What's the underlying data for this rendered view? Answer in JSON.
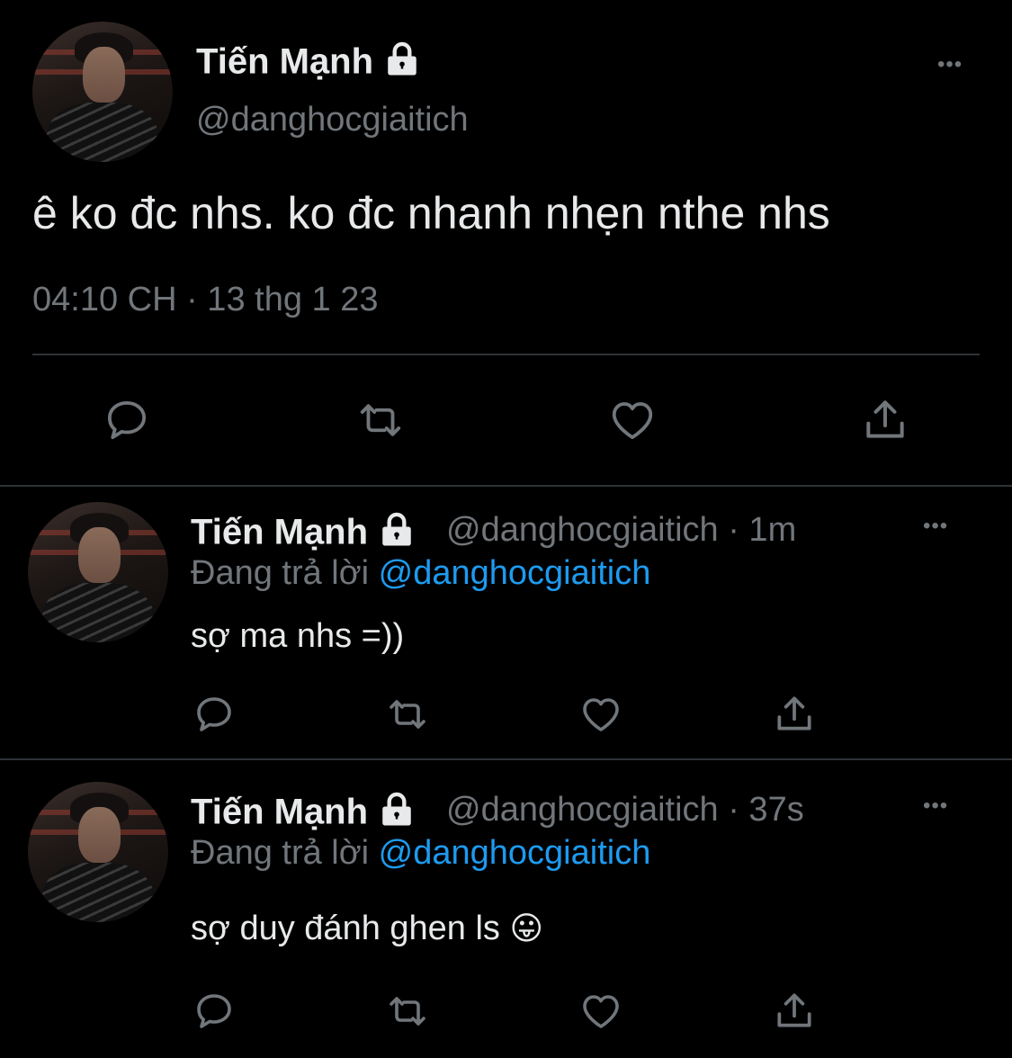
{
  "main_tweet": {
    "display_name": "Tiến Mạnh",
    "handle": "@danghocgiaitich",
    "text": "ê ko đc nhs. ko đc nhanh nhẹn nthe nhs",
    "timestamp": "04:10 CH · 13 thg 1 23",
    "more_label": "•••",
    "actions": [
      "reply-icon",
      "retweet-icon",
      "like-icon",
      "share-icon"
    ]
  },
  "replies": [
    {
      "display_name": "Tiến Mạnh",
      "handle_time": "@danghocgiaitich · 1m",
      "replying_prefix": "Đang trả lời",
      "replying_to": "@danghocgiaitich",
      "text": "sợ ma nhs =))",
      "more_label": "•••"
    },
    {
      "display_name": "Tiến Mạnh",
      "handle_time": "@danghocgiaitich · 37s",
      "replying_prefix": "Đang trả lời",
      "replying_to": "@danghocgiaitich",
      "text": "sợ duy đánh ghen ls",
      "emoji": "😛",
      "more_label": "•••"
    }
  ],
  "colors": {
    "background": "#000000",
    "text": "#e7e9ea",
    "secondary": "#71767b",
    "link": "#1d9bf0",
    "divider": "#2f3336"
  }
}
